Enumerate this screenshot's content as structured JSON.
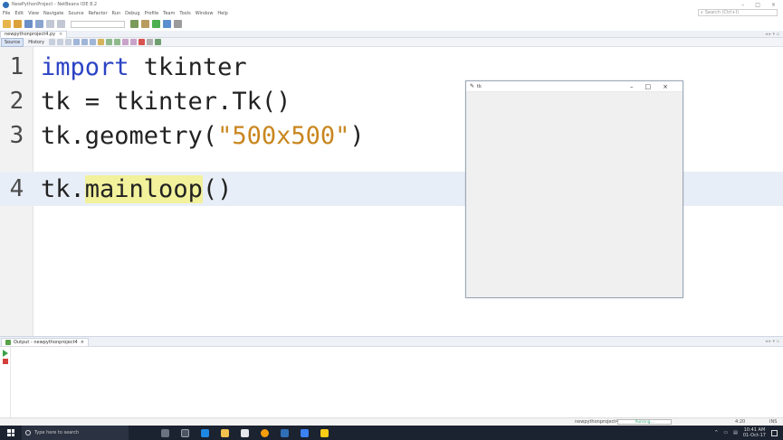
{
  "window": {
    "title": "NewPythonProject - NetBeans IDE 8.2",
    "controls": [
      "–",
      "□",
      "×"
    ]
  },
  "menu": [
    "File",
    "Edit",
    "View",
    "Navigate",
    "Source",
    "Refactor",
    "Run",
    "Debug",
    "Profile",
    "Team",
    "Tools",
    "Window",
    "Help"
  ],
  "search": {
    "placeholder": "Search (Ctrl+I)"
  },
  "editor_tab": {
    "label": "newpythonproject4.py",
    "close": "×"
  },
  "editor_views": {
    "source": "Source",
    "history": "History"
  },
  "code": [
    {
      "num": "1",
      "kw": "import",
      "rest": " tkinter"
    },
    {
      "num": "2",
      "text": "tk = tkinter.Tk()"
    },
    {
      "num": "3",
      "pre": "tk.geometry(",
      "str": "\"500x500\"",
      "post": ")"
    },
    {
      "num": "4",
      "pre": "tk.",
      "hl": "mainloop",
      "post": "()"
    }
  ],
  "tk_window": {
    "title": "tk",
    "controls": [
      "–",
      "□",
      "×"
    ]
  },
  "output": {
    "tab_label": "Output - newpythonproject4",
    "close": "×"
  },
  "status": {
    "project": "newpythonproject4",
    "progress": "Running...",
    "position": "4:20",
    "mode": "INS"
  },
  "taskbar": {
    "search_placeholder": "Type here to search",
    "time": "10:41 AM",
    "date": "01-Oct-17"
  },
  "colors": {
    "keyword": "#2b43c4",
    "string": "#c9861f",
    "highlight": "#f2f19c",
    "current_line": "#e8eef7"
  }
}
